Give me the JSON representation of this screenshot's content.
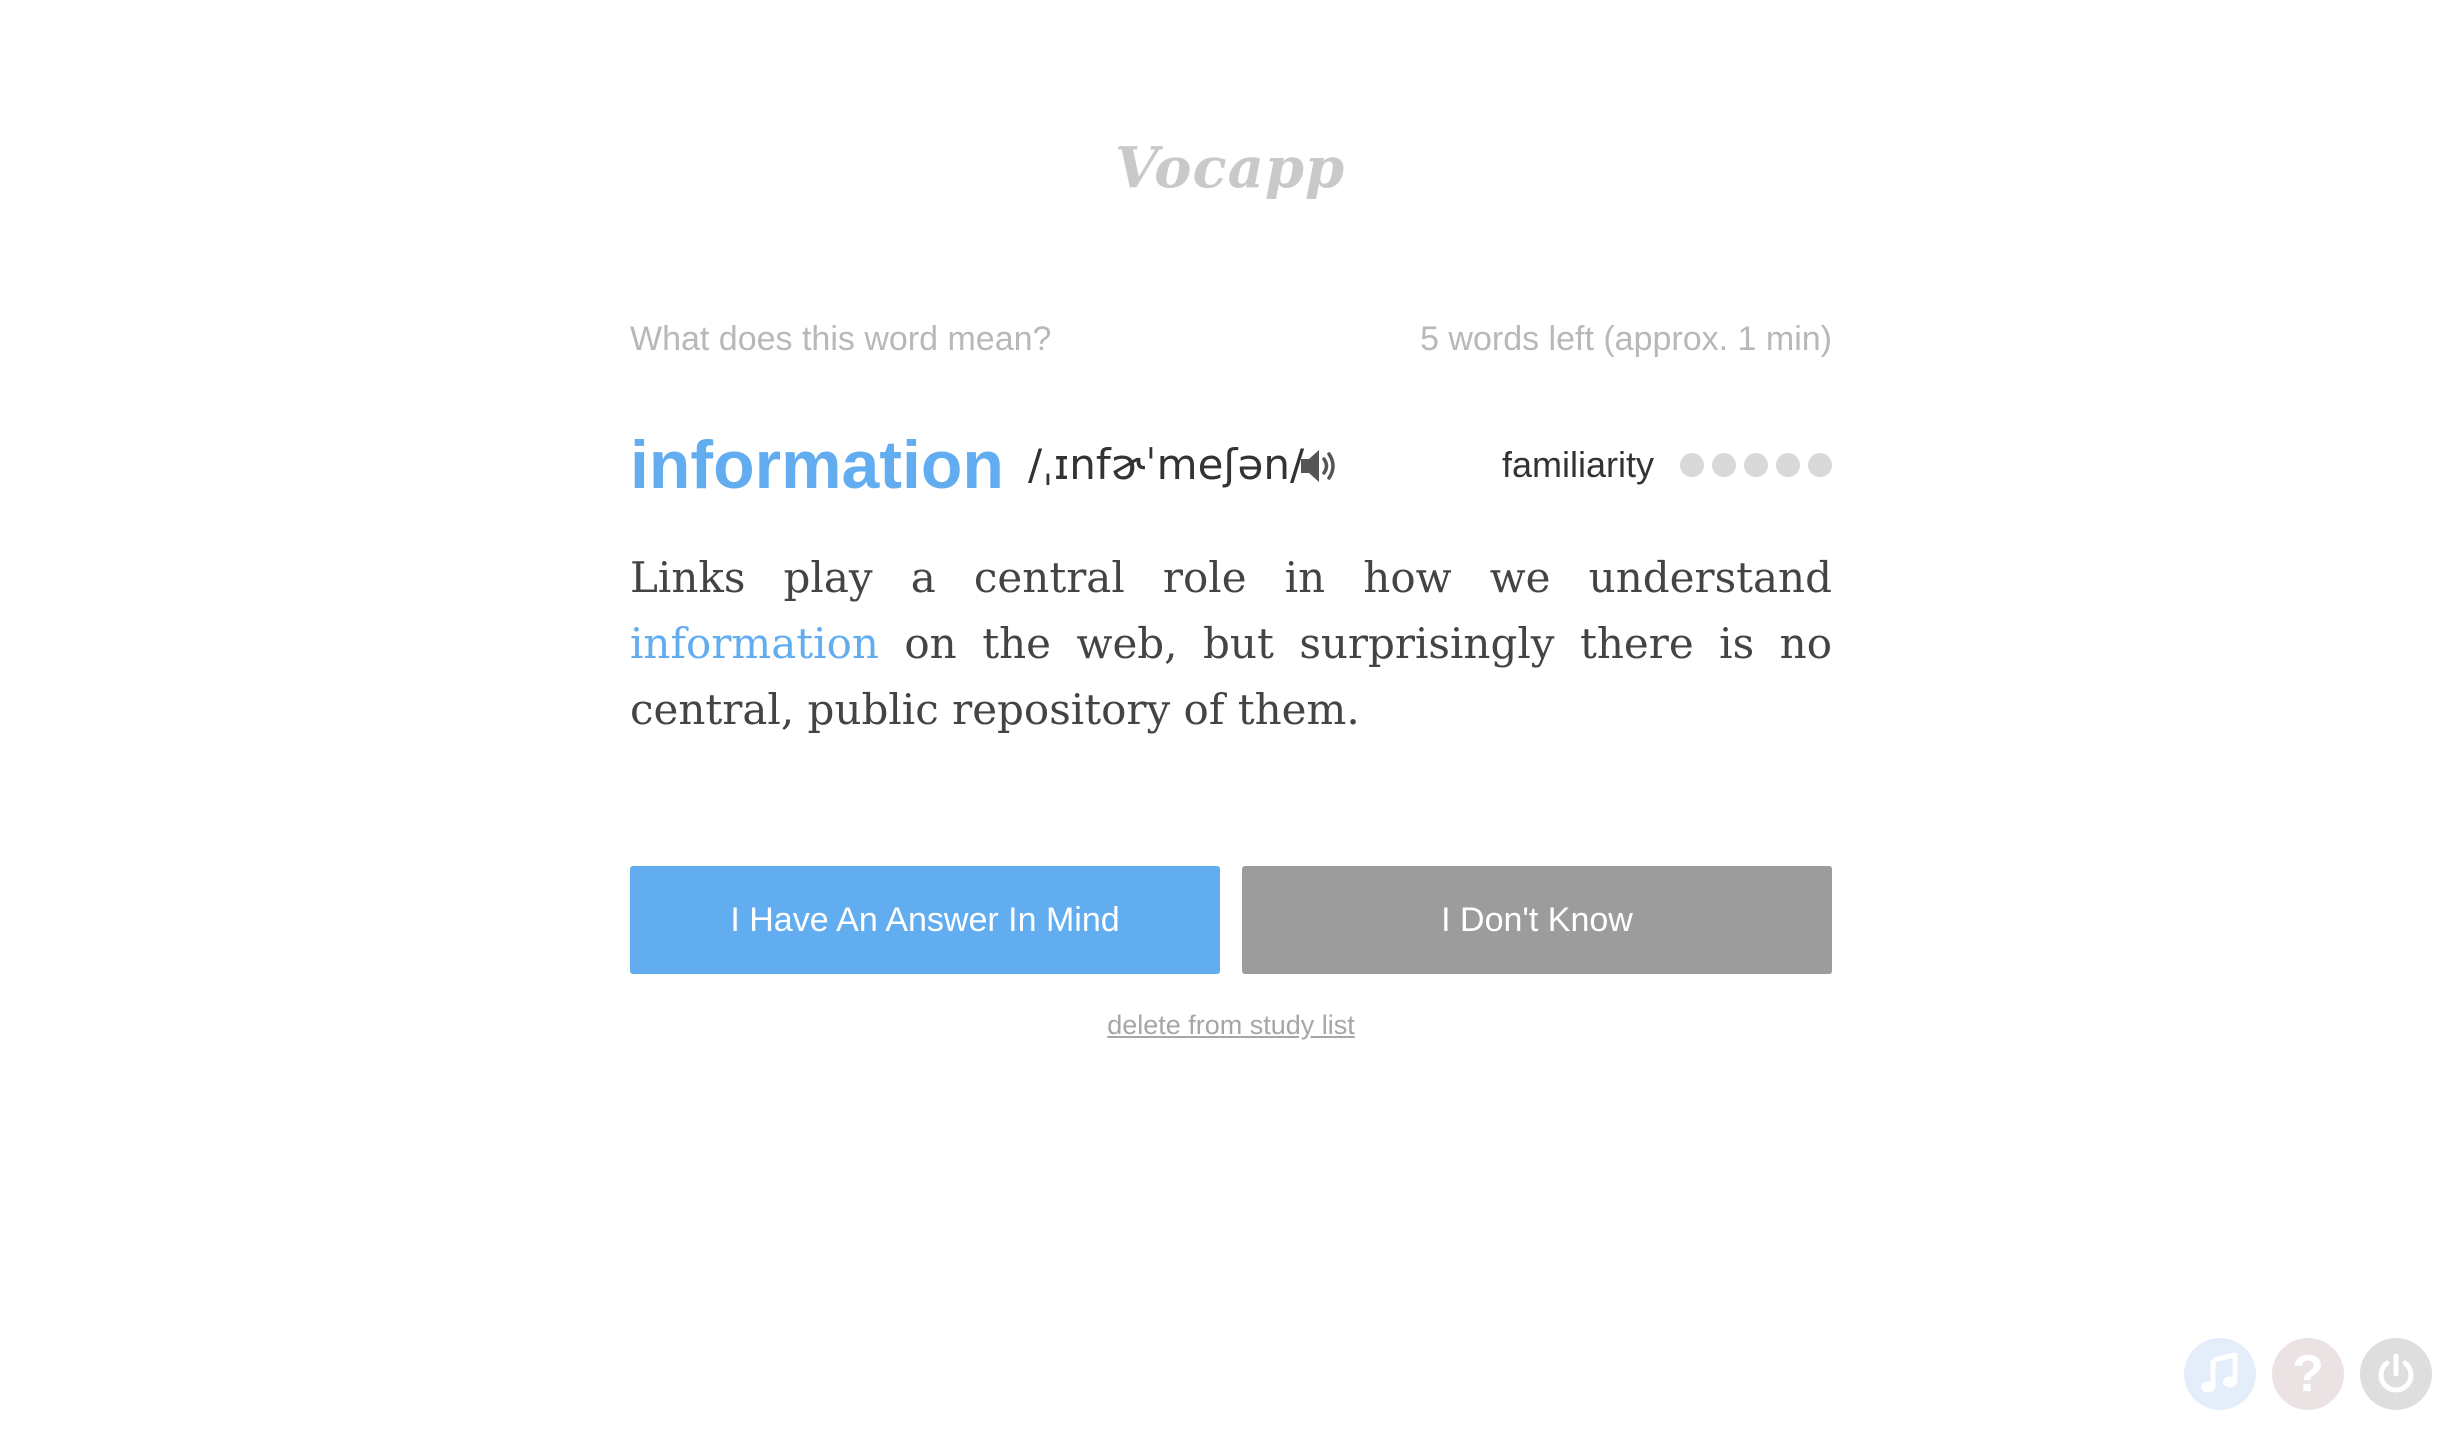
{
  "app": {
    "logo": "Vocapp"
  },
  "quiz": {
    "prompt": "What does this word mean?",
    "remaining": "5 words left (approx. 1 min)",
    "word": "information",
    "pronunciation": "/ˌɪnfɚˈmeʃən/",
    "familiarity_label": "familiarity",
    "familiarity_level": 0,
    "familiarity_max": 5,
    "sentence_before": "Links play a central role in how we understand ",
    "sentence_highlight": "information",
    "sentence_after": " on the web, but surprisingly there is no central, public repository of them."
  },
  "actions": {
    "answer_label": "I Have An Answer In Mind",
    "dont_know_label": "I Don't Know",
    "delete_label": "delete from study list"
  },
  "corner_icons": [
    "music-icon",
    "help-icon",
    "power-icon"
  ],
  "colors": {
    "accent": "#62adf0",
    "secondary_button": "#9c9c9c",
    "muted_text": "#b8b8b8",
    "dot_inactive": "#d8d8d8"
  }
}
